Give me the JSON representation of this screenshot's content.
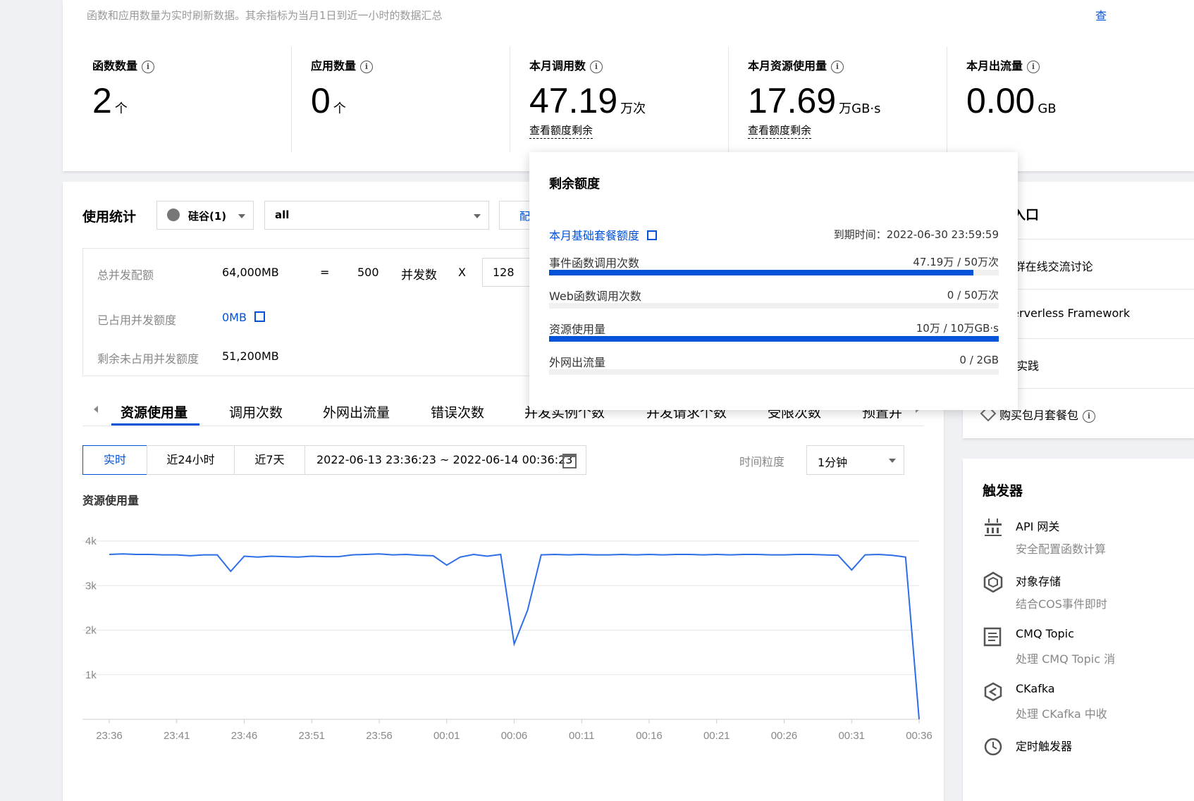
{
  "overview": {
    "note": "函数和应用数量为实时刷新数据。其余指标为当月1日到近一小时的数据汇总",
    "top_right_link": "查",
    "stats": [
      {
        "label": "函数数量",
        "value": "2",
        "unit": "个",
        "link": ""
      },
      {
        "label": "应用数量",
        "value": "0",
        "unit": "个",
        "link": ""
      },
      {
        "label": "本月调用数",
        "value": "47.19",
        "unit": "万次",
        "link": "查看额度剩余"
      },
      {
        "label": "本月资源使用量",
        "value": "17.69",
        "unit": "万GB·s",
        "link": "查看额度剩余"
      },
      {
        "label": "本月出流量",
        "value": "0.00",
        "unit": "GB",
        "link": ""
      }
    ]
  },
  "usage": {
    "title": "使用统计",
    "region": "硅谷(1)",
    "namespace": "all",
    "config_btn": "配",
    "quota": {
      "total_label": "总并发配额",
      "total_value": "64,000MB",
      "eq": "=",
      "concurrency": "500",
      "concurrency_label": "并发数",
      "times": "X",
      "mem_value": "128",
      "used_label": "已占用并发额度",
      "used_value": "0MB",
      "remaining_label": "剩余未占用并发额度",
      "remaining_value": "51,200MB"
    },
    "tabs": [
      "资源使用量",
      "调用次数",
      "外网出流量",
      "错误次数",
      "并发实例个数",
      "并发请求个数",
      "受限次数",
      "预置并"
    ],
    "time_buttons": [
      "实时",
      "近24小时",
      "近7天"
    ],
    "date_range": "2022-06-13 23:36:23 ~ 2022-06-14 00:36:23",
    "granularity_label": "时间粒度",
    "granularity_value": "1分钟"
  },
  "popover": {
    "title": "剩余额度",
    "package_link": "本月基础套餐额度",
    "expiry": "到期时间：2022-06-30 23:59:59",
    "rows": [
      {
        "label": "事件函数调用次数",
        "value": "47.19万 / 50万次",
        "fraction": 0.944
      },
      {
        "label": "Web函数调用次数",
        "value": "0 / 50万次",
        "fraction": 0
      },
      {
        "label": "资源使用量",
        "value": "10万 / 10万GB·s",
        "fraction": 1.0
      },
      {
        "label": "外网出流量",
        "value": "0 / 2GB",
        "fraction": 0
      }
    ]
  },
  "sidebar": {
    "entry_title_partial": "入口",
    "entry_items": [
      "Q群在线交流讨论",
      "Serverless Framework",
      "佳实践"
    ],
    "buy_link": "购买包月套餐包",
    "trigger_title": "触发器",
    "triggers": [
      {
        "icon": "api-gateway-icon",
        "title": "API 网关",
        "desc": "安全配置函数计算"
      },
      {
        "icon": "cos-storage-icon",
        "title": "对象存储",
        "desc": "结合COS事件即时"
      },
      {
        "icon": "cmq-topic-icon",
        "title": "CMQ Topic",
        "desc": "处理 CMQ Topic 消"
      },
      {
        "icon": "ckafka-icon",
        "title": "CKafka",
        "desc": "处理 CKafka 中收"
      },
      {
        "icon": "timer-icon",
        "title": "定时触发器",
        "desc": ""
      }
    ]
  },
  "chart_data": {
    "type": "line",
    "title": "资源使用量",
    "ylim": [
      0,
      4000
    ],
    "yticks": [
      "1k",
      "2k",
      "3k",
      "4k"
    ],
    "x_labels": [
      "23:36",
      "23:41",
      "23:46",
      "23:51",
      "23:56",
      "00:01",
      "00:06",
      "00:11",
      "00:16",
      "00:21",
      "00:26",
      "00:31",
      "00:36"
    ],
    "x": [
      "23:36",
      "23:37",
      "23:38",
      "23:39",
      "23:40",
      "23:41",
      "23:42",
      "23:43",
      "23:44",
      "23:45",
      "23:46",
      "23:47",
      "23:48",
      "23:49",
      "23:50",
      "23:51",
      "23:52",
      "23:53",
      "23:54",
      "23:55",
      "23:56",
      "23:57",
      "23:58",
      "23:59",
      "00:00",
      "00:01",
      "00:02",
      "00:03",
      "00:04",
      "00:05",
      "00:06",
      "00:07",
      "00:08",
      "00:09",
      "00:10",
      "00:11",
      "00:12",
      "00:13",
      "00:14",
      "00:15",
      "00:16",
      "00:17",
      "00:18",
      "00:19",
      "00:20",
      "00:21",
      "00:22",
      "00:23",
      "00:24",
      "00:25",
      "00:26",
      "00:27",
      "00:28",
      "00:29",
      "00:30",
      "00:31",
      "00:32",
      "00:33",
      "00:34",
      "00:35",
      "00:36"
    ],
    "series": [
      {
        "color": "#2d6ee8",
        "values": [
          3700,
          3710,
          3700,
          3700,
          3690,
          3690,
          3670,
          3690,
          3690,
          3320,
          3660,
          3640,
          3660,
          3650,
          3640,
          3660,
          3650,
          3650,
          3690,
          3700,
          3710,
          3690,
          3700,
          3680,
          3670,
          3460,
          3640,
          3700,
          3660,
          3700,
          1690,
          2450,
          3690,
          3700,
          3690,
          3700,
          3690,
          3690,
          3700,
          3690,
          3700,
          3690,
          3700,
          3700,
          3690,
          3700,
          3690,
          3700,
          3700,
          3690,
          3690,
          3700,
          3700,
          3690,
          3680,
          3350,
          3690,
          3700,
          3680,
          3640,
          0
        ]
      }
    ]
  }
}
